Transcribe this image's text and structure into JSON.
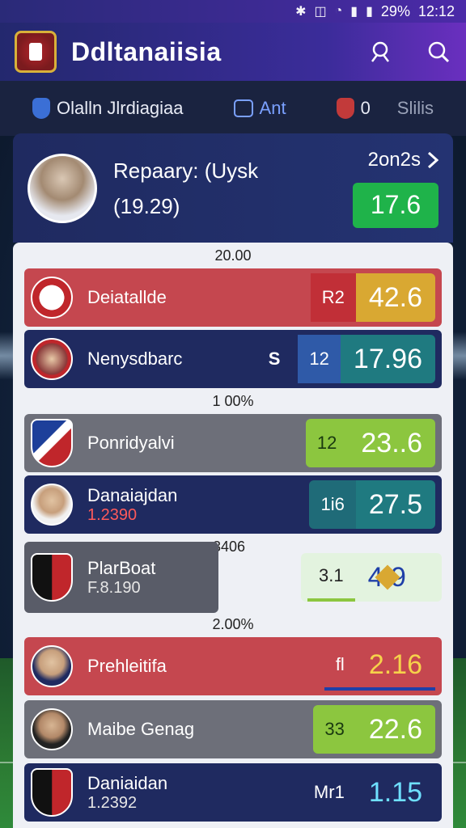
{
  "status": {
    "battery": "29%",
    "time": "12:12"
  },
  "header": {
    "title": "Ddltanaiisia"
  },
  "subnav": [
    {
      "label": "Olalln Jlrdiagiaa"
    },
    {
      "label": "Ant"
    },
    {
      "label": "0"
    },
    {
      "label": "Slilis"
    }
  ],
  "featured": {
    "name": "Repaary: (Uysk",
    "stat": "(19.29)",
    "score": "2on2s",
    "badge": "17.6"
  },
  "sections": [
    "20.00",
    "1 00%",
    "3406",
    "2.00%"
  ],
  "rows": [
    {
      "name": "Deiatallde",
      "sub": "",
      "small": "R2",
      "big": "42.6"
    },
    {
      "name": "Nenysdbarc",
      "sub": "",
      "mid": "S",
      "small": "12",
      "big": "17.96"
    },
    {
      "name": "Ponridyalvi",
      "sub": "",
      "small": "12",
      "big": "23..6"
    },
    {
      "name": "Danaiajdan",
      "sub": "1.2390",
      "small": "1i6",
      "big": "27.5"
    },
    {
      "name": "PlarBoat",
      "sub": "F.8.190",
      "small": "3.1",
      "big": "4 9"
    },
    {
      "name": "Prehleitifa",
      "sub": "",
      "small": "fl",
      "big": "2.16"
    },
    {
      "name": "Maibe Genag",
      "sub": "",
      "small": "33",
      "big": "22.6"
    },
    {
      "name": "Daniaidan",
      "sub": "1.2392",
      "small": "Mr1",
      "big": "1.15"
    }
  ],
  "colors": {
    "green": "#1fb34a",
    "gold": "#d9a832",
    "teal": "#1f7a80",
    "lime": "#8cc63f",
    "red_row": "#c5474f",
    "navy_row": "#1f2a60"
  }
}
